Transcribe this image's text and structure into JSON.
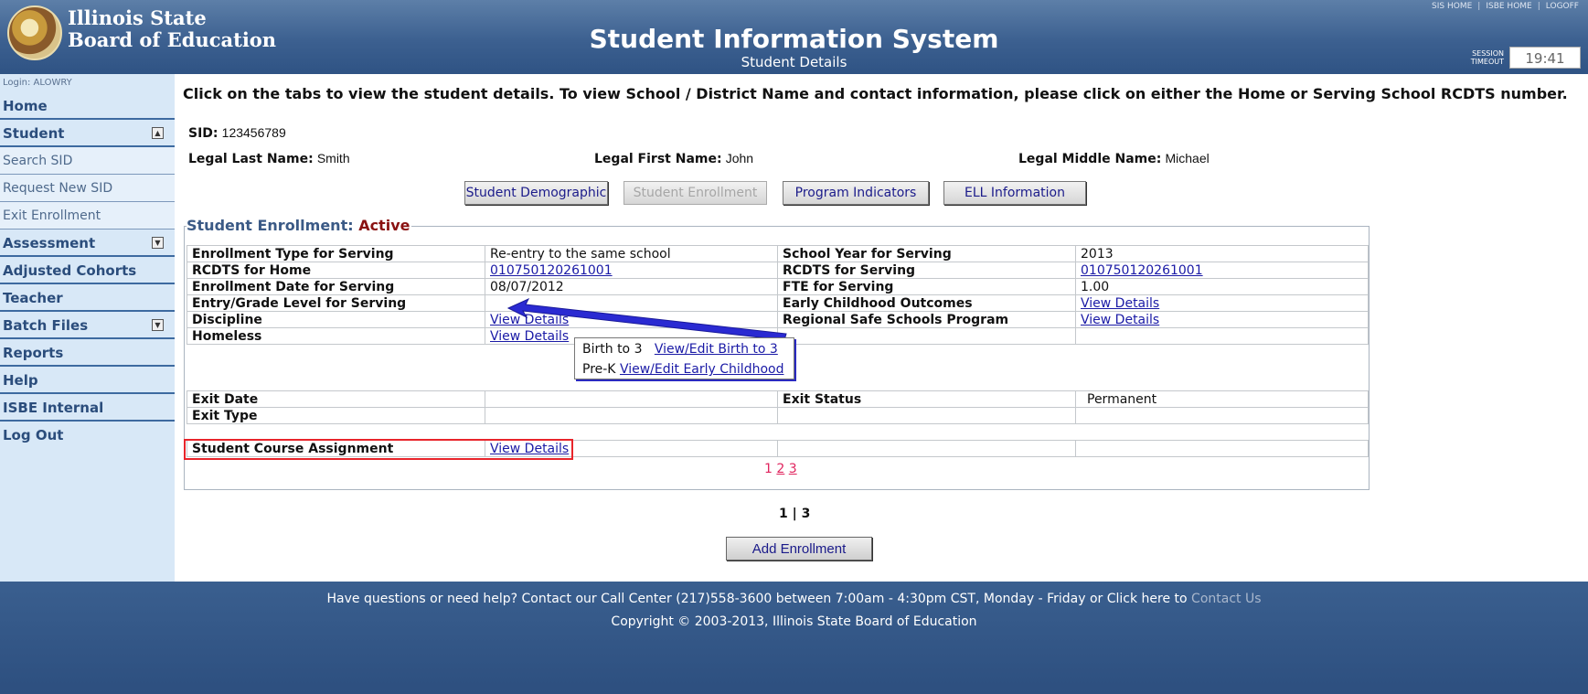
{
  "header": {
    "brand_line1": "Illinois State",
    "brand_line2": "Board of Education",
    "title": "Student Information System",
    "subtitle": "Student Details",
    "top_links": [
      "SIS HOME",
      "ISBE HOME",
      "LOGOFF"
    ],
    "timeout_label1": "SESSION",
    "timeout_label2": "TIMEOUT",
    "timeout_value": "19:41"
  },
  "sidebar": {
    "login": "Login: ALOWRY",
    "items": [
      {
        "label": "Home"
      },
      {
        "label": "Student",
        "toggle": "up"
      },
      {
        "label": "Search SID"
      },
      {
        "label": "Request New SID"
      },
      {
        "label": "Exit Enrollment"
      },
      {
        "label": "Assessment",
        "toggle": "down"
      },
      {
        "label": "Adjusted Cohorts"
      },
      {
        "label": "Teacher"
      },
      {
        "label": "Batch Files",
        "toggle": "down"
      },
      {
        "label": "Reports"
      },
      {
        "label": "Help"
      },
      {
        "label": "ISBE Internal"
      },
      {
        "label": "Log Out"
      }
    ]
  },
  "main": {
    "instructions": "Click on the tabs to view the student details. To view School / District Name and contact information, please click on either the Home or Serving School RCDTS number.",
    "sid_label": "SID:",
    "sid_value": "123456789",
    "last_label": "Legal Last Name:",
    "last_value": "Smith",
    "first_label": "Legal First Name:",
    "first_value": "John",
    "middle_label": "Legal Middle Name:",
    "middle_value": "Michael",
    "tabs": [
      {
        "label": "Student Demographic"
      },
      {
        "label": "Student Enrollment"
      },
      {
        "label": "Program Indicators"
      },
      {
        "label": "ELL Information"
      }
    ],
    "enrollment_label": "Student Enrollment:",
    "enrollment_status": "Active",
    "grid1": [
      [
        "Enrollment Type for Serving",
        "Re-entry to the same school",
        "School Year for Serving",
        "2013"
      ],
      [
        "RCDTS for Home",
        "010750120261001",
        "RCDTS for Serving",
        "010750120261001"
      ],
      [
        "Enrollment Date for Serving",
        "08/07/2012",
        "FTE for Serving",
        "1.00"
      ],
      [
        "Entry/Grade Level for Serving",
        "",
        "Early Childhood Outcomes",
        "View Details"
      ],
      [
        "Discipline",
        "View Details",
        "Regional Safe Schools Program",
        "View Details"
      ],
      [
        "Homeless",
        "View Details",
        "",
        ""
      ]
    ],
    "grid2": [
      [
        "Exit Date",
        "",
        "Exit Status",
        "Permanent"
      ],
      [
        "Exit Type",
        "",
        "",
        ""
      ]
    ],
    "course_label": "Student Course Assignment",
    "course_link": "View Details",
    "pager_current": "1",
    "pager_links": [
      "2",
      "3"
    ],
    "page_count": "1 | 3",
    "add_button": "Add Enrollment"
  },
  "popup": {
    "row1_label": "Birth to 3",
    "row1_link": "View/Edit Birth to 3",
    "row2_label": "Pre-K",
    "row2_link": "View/Edit Early Childhood"
  },
  "footer": {
    "help_text": "Have questions or need help? Contact our Call Center (217)558-3600 between 7:00am - 4:30pm CST, Monday - Friday or Click here to ",
    "contact_link": "Contact Us",
    "copyright": "Copyright © 2003-2013, Illinois State Board of Education"
  }
}
